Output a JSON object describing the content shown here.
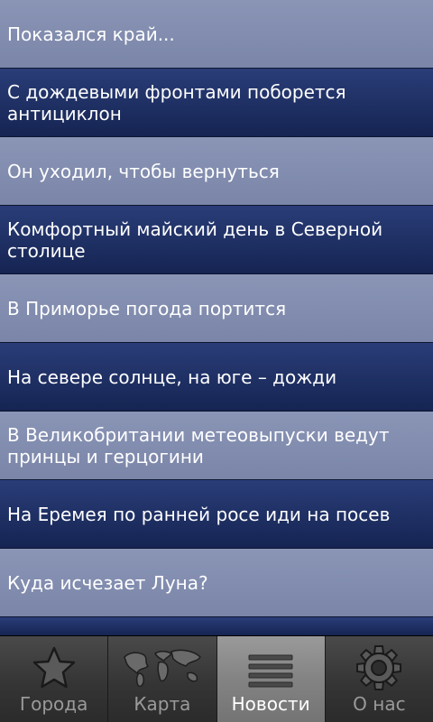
{
  "news": {
    "items": [
      {
        "title": "Показался край..."
      },
      {
        "title": "С дождевыми фронтами поборется антициклон"
      },
      {
        "title": "Он уходил, чтобы вернуться"
      },
      {
        "title": "Комфортный майский день в Северной столице"
      },
      {
        "title": "В Приморье погода портится"
      },
      {
        "title": "На севере солнце, на юге – дожди"
      },
      {
        "title": "В Великобритании метеовыпуски ведут принцы и герцогини"
      },
      {
        "title": "На Еремея по ранней росе иди на посев"
      },
      {
        "title": "Куда исчезает Луна?"
      }
    ]
  },
  "tabs": [
    {
      "label": "Города",
      "icon": "star-icon",
      "active": false
    },
    {
      "label": "Карта",
      "icon": "world-map-icon",
      "active": false
    },
    {
      "label": "Новости",
      "icon": "list-icon",
      "active": true
    },
    {
      "label": "О нас",
      "icon": "gear-icon",
      "active": false
    }
  ],
  "colors": {
    "row_light": "#7f8aad",
    "row_dark": "#1d2d62",
    "tab_bg": "#353535",
    "tab_active_bg": "#838383"
  }
}
